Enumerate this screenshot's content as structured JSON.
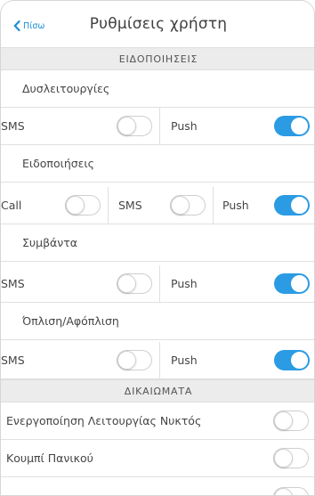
{
  "header": {
    "back_label": "Πίσω",
    "title": "Ρυθμίσεις χρήστη"
  },
  "colors": {
    "accent": "#2b9be4",
    "section_bg": "#ececec",
    "text": "#454545"
  },
  "sections": [
    {
      "title": "ΕΙΔΟΠΟΙΗΣΕΙΣ",
      "groups": [
        {
          "label": "Δυσλειτουργίες",
          "options": [
            {
              "label": "SMS",
              "on": false
            },
            {
              "label": "Push",
              "on": true
            }
          ]
        },
        {
          "label": "Ειδοποιήσεις",
          "options": [
            {
              "label": "Call",
              "on": false
            },
            {
              "label": "SMS",
              "on": false
            },
            {
              "label": "Push",
              "on": true
            }
          ]
        },
        {
          "label": "Συμβάντα",
          "options": [
            {
              "label": "SMS",
              "on": false
            },
            {
              "label": "Push",
              "on": true
            }
          ]
        },
        {
          "label": "Όπλιση/Αφόπλιση",
          "options": [
            {
              "label": "SMS",
              "on": false
            },
            {
              "label": "Push",
              "on": true
            }
          ]
        }
      ]
    },
    {
      "title": "ΔΙΚΑΙΩΜΑΤΑ",
      "items": [
        {
          "label": "Ενεργοποίηση Λειτουργίας Νυκτός",
          "on": false
        },
        {
          "label": "Κουμπί Πανικού",
          "on": false
        }
      ]
    }
  ]
}
